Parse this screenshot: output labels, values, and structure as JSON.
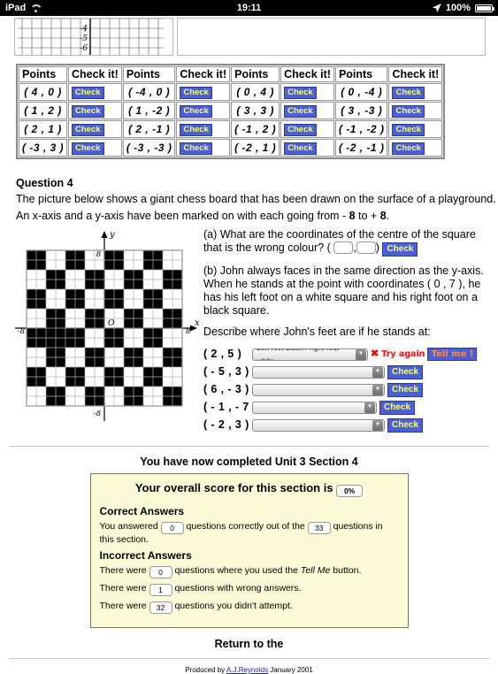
{
  "statusbar": {
    "device": "iPad",
    "wifi_icon": "wifi-icon",
    "time": "19:11",
    "location_icon": "location-arrow-icon",
    "battery_percent": "100%",
    "battery_icon": "battery-full-icon"
  },
  "top_graph": {
    "visible_y_labels": [
      "-4",
      "-5",
      "-6"
    ]
  },
  "coord_table": {
    "headers": [
      "Points",
      "Check it!",
      "Points",
      "Check it!",
      "Points",
      "Check it!",
      "Points",
      "Check it!"
    ],
    "check_label": "Check",
    "rows": [
      [
        "( 4 , 0 )",
        "Check",
        "( -4 , 0 )",
        "Check",
        "( 0 , 4 )",
        "Check",
        "( 0 , -4 )",
        "Check"
      ],
      [
        "( 1 , 2 )",
        "Check",
        "( 1 , -2 )",
        "Check",
        "( 3 , 3 )",
        "Check",
        "( 3 , -3 )",
        "Check"
      ],
      [
        "( 2 , 1 )",
        "Check",
        "( 2 , -1 )",
        "Check",
        "( -1 , 2 )",
        "Check",
        "( -1 , -2 )",
        "Check"
      ],
      [
        "( -3 , 3 )",
        "Check",
        "( -3 , -3 )",
        "Check",
        "( -2 , 1 )",
        "Check",
        "( -2 , -1 )",
        "Check"
      ]
    ]
  },
  "question4": {
    "heading": "Question 4",
    "intro_line1": "The picture below shows a giant chess board that has been drawn on the surface of a playground.",
    "intro_line2_a": "An x-axis and a y-axis have been marked on with each going from - ",
    "intro_line2_b": "8",
    "intro_line2_c": " to + ",
    "intro_line2_d": "8",
    "intro_line2_e": ".",
    "part_a": "(a) What are the coordinates of the centre of the square that is the wrong colour? (",
    "part_a_comma": ",",
    "part_a_close": ")",
    "part_a_check": "Check",
    "part_b": "(b) John always faces in the same direction as the y-axis. When he stands at the point with coordinates ( 0 , 7 ), he has his left foot on a white square and his right foot on a black square.",
    "describe": "Describe where John's feet are if he stands at:",
    "feet_rows": [
      {
        "coord": "( 2 , 5 )",
        "selected": "Left foot black / right foot white",
        "feedback": "Try again",
        "feedback_icon": "red-x-icon",
        "tellme": "Tell me !",
        "check": ""
      },
      {
        "coord": "( - 5 , 3 )",
        "selected": "",
        "feedback": "",
        "tellme": "",
        "check": "Check"
      },
      {
        "coord": "( 6 , - 3 )",
        "selected": "",
        "feedback": "",
        "tellme": "",
        "check": "Check"
      },
      {
        "coord": "( - 1 , - 7 )",
        "selected": "",
        "feedback": "",
        "tellme": "",
        "check": "Check"
      },
      {
        "coord": "( - 2 , 3 )",
        "selected": "",
        "feedback": "",
        "tellme": "",
        "check": "Check"
      }
    ],
    "board": {
      "axis_x_label": "x",
      "axis_y_label": "y",
      "origin_label": "O",
      "label_left": "-8",
      "label_right": "8",
      "label_top": "8",
      "label_bottom": "-8",
      "size": 8,
      "wrong_square": {
        "col": 1,
        "row": 4
      }
    }
  },
  "results": {
    "completed_title": "You have now completed Unit 3 Section 4",
    "score_heading": "Your overall score for this section is",
    "score_value": "0%",
    "correct_heading": "Correct Answers",
    "correct_pre": "You answered",
    "correct_value": "0",
    "correct_mid": "questions correctly out of the",
    "total_value": "33",
    "correct_post": "questions in this section.",
    "incorrect_heading": "Incorrect Answers",
    "row1_pre": "There were",
    "row1_value": "0",
    "row1_mid": "questions where you used the",
    "row1_em": "Tell Me",
    "row1_post": "button.",
    "row2_pre": "There were",
    "row2_value": "1",
    "row2_post": "questions with wrong answers.",
    "row3_pre": "There were",
    "row3_value": "32",
    "row3_post": "questions you didn't attempt."
  },
  "footer": {
    "return_text": "Return to the",
    "produced_pre": "Produced by",
    "author": "A.J.Reynolds",
    "produced_post": "January 2001"
  },
  "colors": {
    "check_bg": "#4b5fd6",
    "check_fg": "#ffff66",
    "tellme_fg": "#ff8a3d",
    "error_red": "#e81010",
    "score_bg": "#fbfbd8"
  }
}
